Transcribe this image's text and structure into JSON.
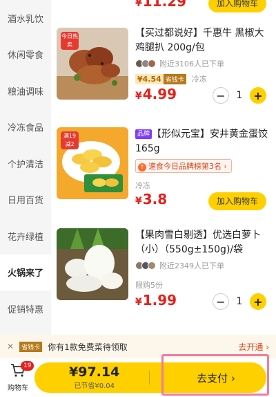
{
  "sidebar": {
    "items": [
      {
        "label": "酒水乳饮"
      },
      {
        "label": "休闲零食"
      },
      {
        "label": "粮油调味"
      },
      {
        "label": "冷冻食品"
      },
      {
        "label": "个护清洁"
      },
      {
        "label": "日用百货"
      },
      {
        "label": "花卉绿植"
      },
      {
        "label": "火锅来了"
      },
      {
        "label": "促销特惠"
      }
    ],
    "active_index": 7
  },
  "products": [
    {
      "price_symbol": "¥",
      "price": "11.29",
      "cart_label": "加入购物车"
    },
    {
      "badge": "今日热卖",
      "title": "【买过都说好】千惠牛 黑椒大鸡腿扒 200g/包",
      "social": "附近3106人已下单",
      "member_price": "¥4.54",
      "member_tag": "省钱卡",
      "storage": "冷冻",
      "price_symbol": "¥",
      "price": "4.99",
      "qty": "1"
    },
    {
      "badge": "满19减2",
      "brand_tag": "品牌",
      "title": "【形似元宝】安井黄金蛋饺 165g",
      "rank_icon": "↑",
      "rank": "速食今日品牌榜第3名",
      "rank_arrow": "›",
      "storage": "冷冻",
      "price_symbol": "¥",
      "price": "3.8",
      "cart_label": "加入购物车"
    },
    {
      "title": "【果肉雪白剔透】优选白萝卜（小）（550g±150g)/袋",
      "social": "附近2349人已下单",
      "limit": "限购5份",
      "price_symbol": "¥",
      "price": "1.99",
      "qty": "1"
    }
  ],
  "stepper": {
    "minus": "−",
    "plus": "+"
  },
  "promo": {
    "tag": "省钱卡",
    "close": "✕",
    "text": "你有1款免费菜待领取",
    "link": "去开通 ›"
  },
  "bottom": {
    "cart_count": "19",
    "cart_label": "购物车",
    "total": "¥97.14",
    "saved": "已节省¥0.04",
    "pay_label": "去支付 ›"
  },
  "colors": {
    "accent": "#ffd000",
    "price": "#e6211a",
    "highlight": "#ef7ca0"
  }
}
